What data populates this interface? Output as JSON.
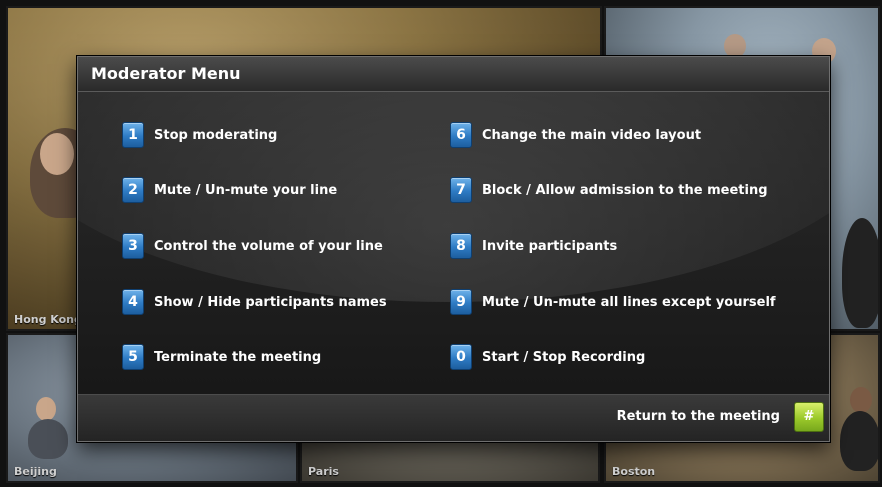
{
  "tiles": {
    "hong_kong": "Hong Kong",
    "beijing": "Beijing",
    "paris": "Paris",
    "boston": "Boston"
  },
  "menu": {
    "title": "Moderator Menu",
    "left_items": [
      {
        "key": "1",
        "label": "Stop moderating"
      },
      {
        "key": "2",
        "label": "Mute / Un-mute your line"
      },
      {
        "key": "3",
        "label": "Control the volume of your line"
      },
      {
        "key": "4",
        "label": "Show / Hide participants names"
      },
      {
        "key": "5",
        "label": "Terminate the meeting"
      }
    ],
    "right_items": [
      {
        "key": "6",
        "label": "Change the main video layout"
      },
      {
        "key": "7",
        "label": "Block / Allow admission to the meeting"
      },
      {
        "key": "8",
        "label": "Invite participants"
      },
      {
        "key": "9",
        "label": "Mute / Un-mute all lines except yourself"
      },
      {
        "key": "0",
        "label": "Start / Stop Recording"
      }
    ],
    "footer": {
      "return_label": "Return to the meeting",
      "return_key": "#"
    }
  },
  "colors": {
    "key_blue": "#2e7bc4",
    "hash_green": "#9bc92a",
    "panel_bg": "#1b1b1b"
  }
}
